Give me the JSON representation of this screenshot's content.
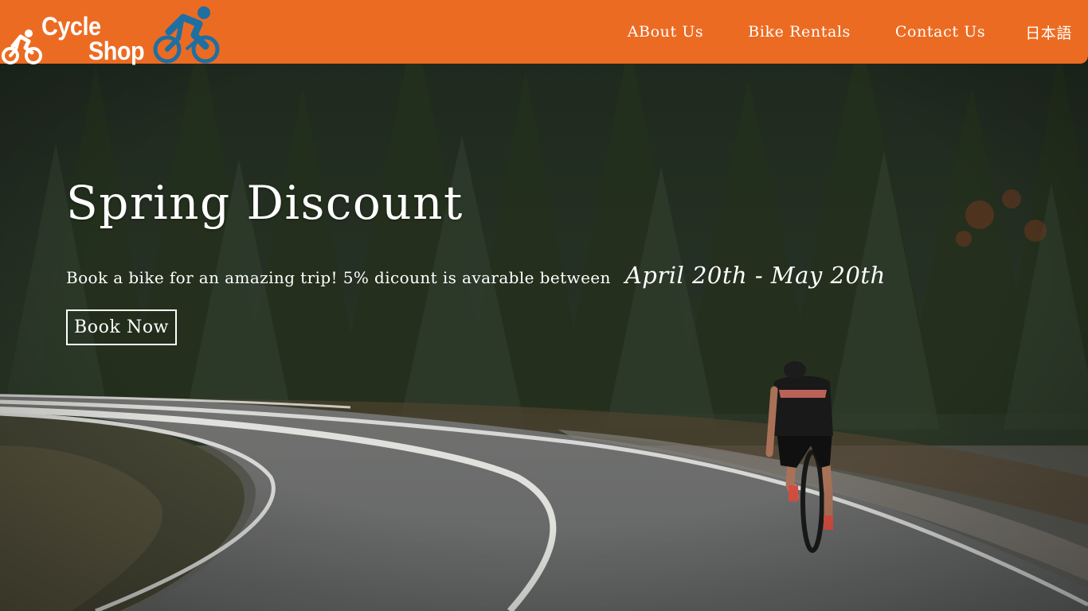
{
  "header": {
    "logo": {
      "line1": "Cycle",
      "line2": "Shop"
    },
    "nav": [
      {
        "label": "ABout Us"
      },
      {
        "label": "Bike Rentals"
      },
      {
        "label": "Contact Us"
      },
      {
        "label": "日本語"
      }
    ]
  },
  "hero": {
    "title": "Spring Discount",
    "subtitle": "Book a bike for an amazing trip! 5% dicount is avarable between",
    "dates": "April 20th - May 20th",
    "cta_label": "Book Now"
  },
  "colors": {
    "header_bg": "#ec6b22",
    "logo_rider_blue": "#1f6fa3",
    "text": "#ffffff"
  }
}
